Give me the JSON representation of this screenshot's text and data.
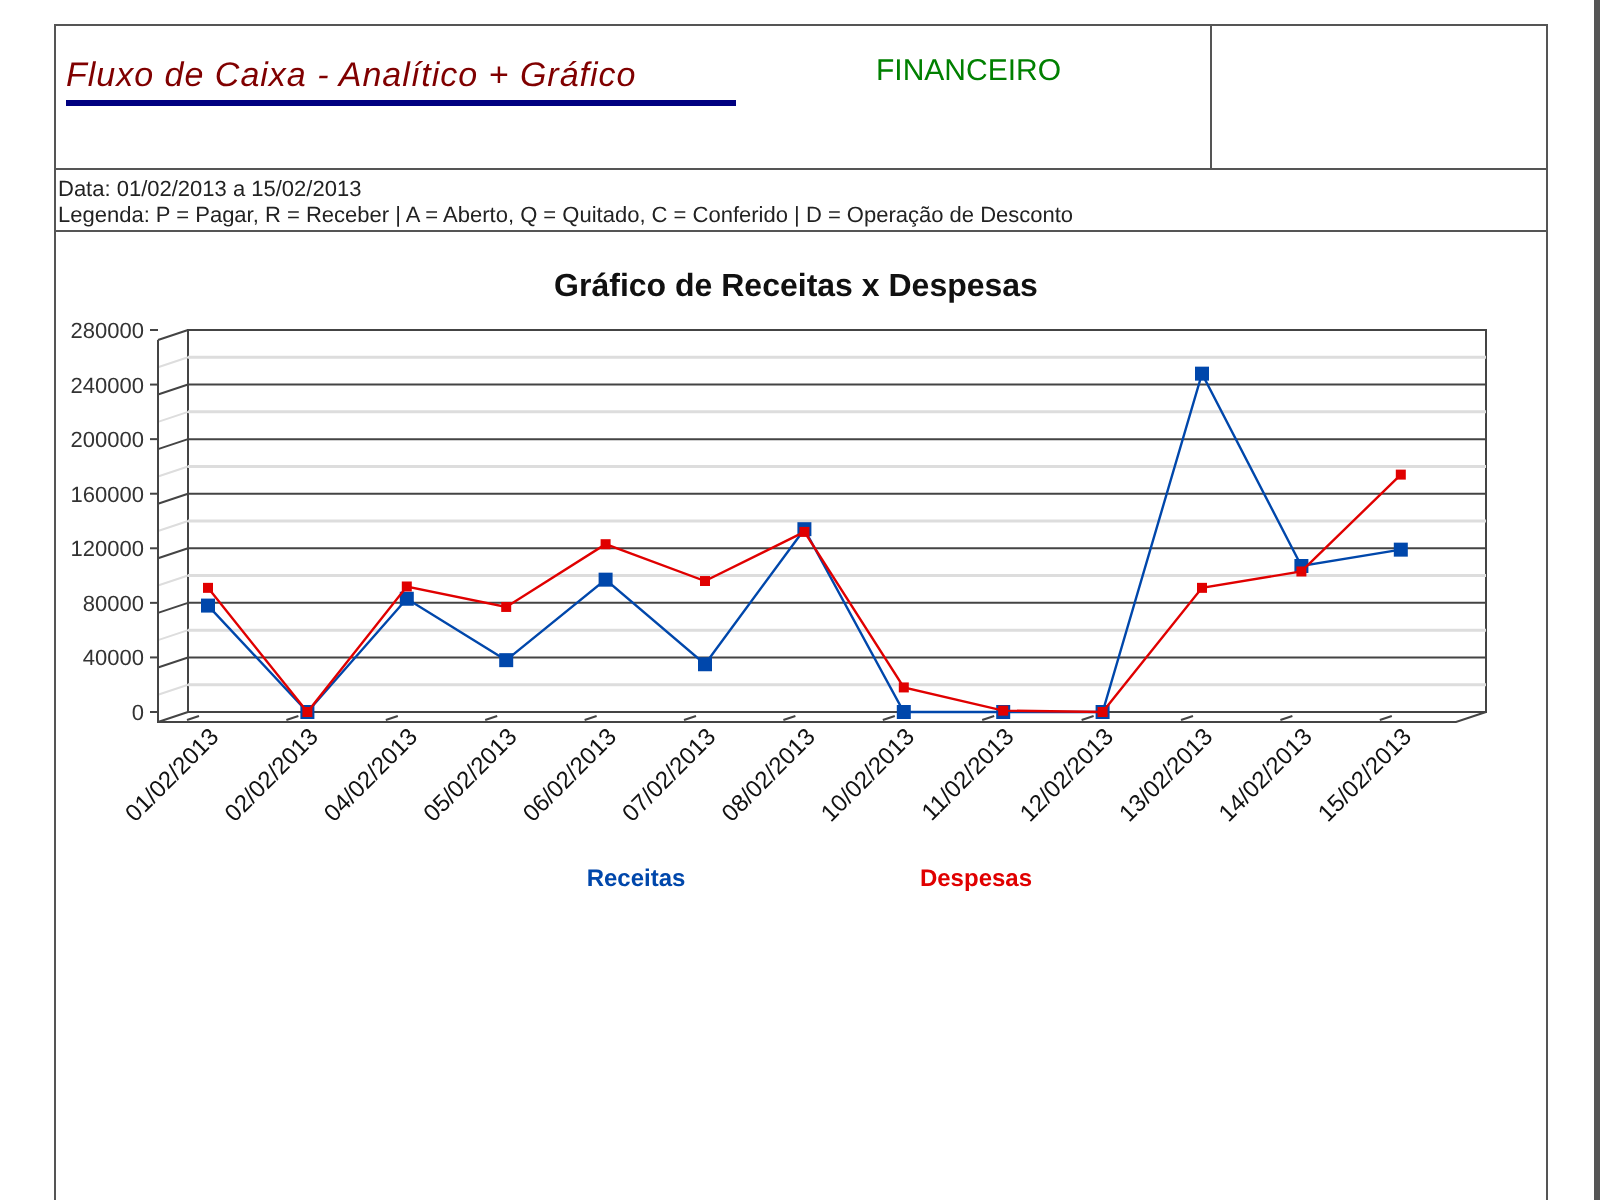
{
  "header": {
    "title": "Fluxo de Caixa - Analítico + Gráfico",
    "module": "FINANCEIRO"
  },
  "info": {
    "period": "Data: 01/02/2013 a 15/02/2013",
    "legend": "Legenda: P = Pagar, R = Receber | A = Aberto, Q = Quitado, C = Conferido | D = Operação de Desconto"
  },
  "chart": {
    "chart_data": {
      "type": "line",
      "title": "Gráfico de Receitas x Despesas",
      "categories": [
        "01/02/2013",
        "02/02/2013",
        "04/02/2013",
        "05/02/2013",
        "06/02/2013",
        "07/02/2013",
        "08/02/2013",
        "10/02/2013",
        "11/02/2013",
        "12/02/2013",
        "13/02/2013",
        "14/02/2013",
        "15/02/2013"
      ],
      "series": [
        {
          "name": "Receitas",
          "color": "#0047ab",
          "marker": "square",
          "values": [
            78000,
            0,
            83000,
            38000,
            97000,
            35000,
            134000,
            0,
            0,
            0,
            248000,
            107000,
            119000
          ]
        },
        {
          "name": "Despesas",
          "color": "#e00000",
          "marker": "square",
          "values": [
            91000,
            0,
            92000,
            77000,
            123000,
            96000,
            132000,
            18000,
            1000,
            0,
            91000,
            103000,
            174000
          ]
        }
      ],
      "ylim": [
        0,
        280000
      ],
      "grid": true,
      "yticks": [
        0,
        40000,
        80000,
        120000,
        160000,
        200000,
        240000,
        280000
      ]
    }
  }
}
